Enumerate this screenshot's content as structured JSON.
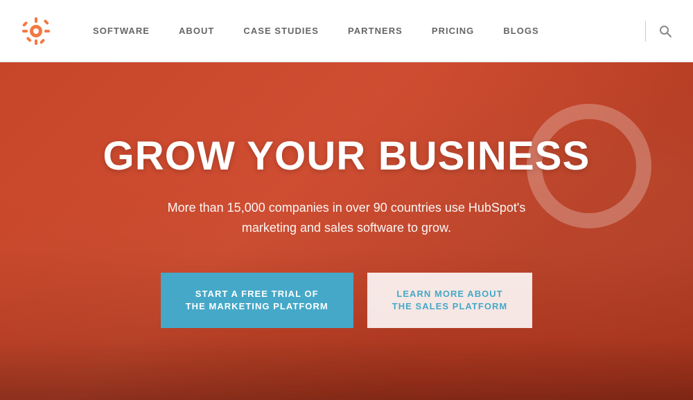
{
  "navbar": {
    "logo_alt": "HubSpot Logo",
    "links": [
      {
        "id": "software",
        "label": "SOFTWARE"
      },
      {
        "id": "about",
        "label": "ABOUT"
      },
      {
        "id": "case-studies",
        "label": "CASE STUDIES"
      },
      {
        "id": "partners",
        "label": "PARTNERS"
      },
      {
        "id": "pricing",
        "label": "PRICING"
      },
      {
        "id": "blogs",
        "label": "BLOGS"
      }
    ],
    "search_aria": "Search"
  },
  "hero": {
    "title": "GROW YOUR BUSINESS",
    "subtitle": "More than 15,000 companies in over 90 countries use HubSpot's marketing and sales software to grow.",
    "btn_marketing_line1": "START A FREE TRIAL OF",
    "btn_marketing_line2": "THE MARKETING PLATFORM",
    "btn_sales_line1": "LEARN MORE ABOUT",
    "btn_sales_line2": "THE SALES PLATFORM"
  },
  "colors": {
    "accent_blue": "#45a8c8",
    "brand_orange": "#e05a38",
    "nav_bg": "#ffffff",
    "nav_text": "#666666"
  }
}
